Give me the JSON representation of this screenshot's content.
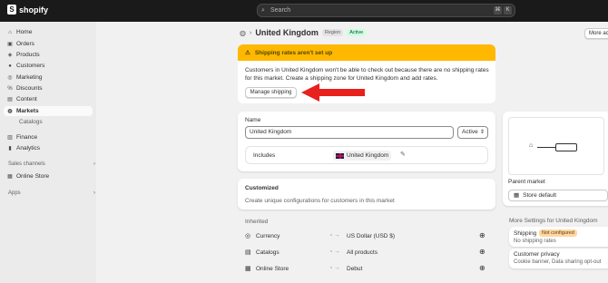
{
  "topbar": {
    "logo_text": "shopify",
    "search_placeholder": "Search",
    "kbd1": "⌘",
    "kbd2": "K"
  },
  "sidebar": {
    "items": [
      {
        "label": "Home",
        "icon": "home-icon",
        "glyph": "⌂"
      },
      {
        "label": "Orders",
        "icon": "orders-icon",
        "glyph": "▣"
      },
      {
        "label": "Products",
        "icon": "products-icon",
        "glyph": "◈"
      },
      {
        "label": "Customers",
        "icon": "customers-icon",
        "glyph": "●"
      },
      {
        "label": "Marketing",
        "icon": "marketing-icon",
        "glyph": "◎"
      },
      {
        "label": "Discounts",
        "icon": "discounts-icon",
        "glyph": "%"
      },
      {
        "label": "Content",
        "icon": "content-icon",
        "glyph": "▤"
      },
      {
        "label": "Markets",
        "icon": "markets-icon",
        "glyph": "◍"
      }
    ],
    "sub_catalogs": "Catalogs",
    "finance": {
      "label": "Finance",
      "glyph": "▥"
    },
    "analytics": {
      "label": "Analytics",
      "glyph": "▮"
    },
    "sales_channels": "Sales channels",
    "online_store": {
      "label": "Online Store",
      "glyph": "▦"
    },
    "apps": "Apps"
  },
  "header": {
    "title": "United Kingdom",
    "badge_region": "Region",
    "badge_status": "Active",
    "more_actions": "More ac"
  },
  "warning": {
    "title": "Shipping rates aren't set up",
    "body": "Customers in United Kingdom won't be able to check out because there are no shipping rates for this market. Create a shipping zone for United Kingdom and add rates.",
    "button": "Manage shipping"
  },
  "name_card": {
    "name_label": "Name",
    "name_value": "United Kingdom",
    "status_value": "Active",
    "includes_label": "Includes",
    "includes_value": "United Kingdom"
  },
  "customized": {
    "title": "Customized",
    "description": "Create unique configurations for customers in this market"
  },
  "inherited": {
    "title": "Inherited",
    "rows": [
      {
        "label": "Currency",
        "value": "US Dollar (USD $)"
      },
      {
        "label": "Catalogs",
        "value": "All products"
      },
      {
        "label": "Online Store",
        "value": "Debut"
      }
    ]
  },
  "right": {
    "parent_market_label": "Parent market",
    "parent_market_value": "Store default",
    "more_settings": "More Settings for United Kingdom",
    "shipping_label": "Shipping",
    "shipping_badge": "Not configured",
    "shipping_sub": "No shipping rates",
    "privacy_label": "Customer privacy",
    "privacy_sub": "Cookie banner, Data sharing opt-out"
  },
  "colors": {
    "warning": "#ffb800",
    "arrow": "#e8201e",
    "active_badge": "#cdfee1"
  }
}
